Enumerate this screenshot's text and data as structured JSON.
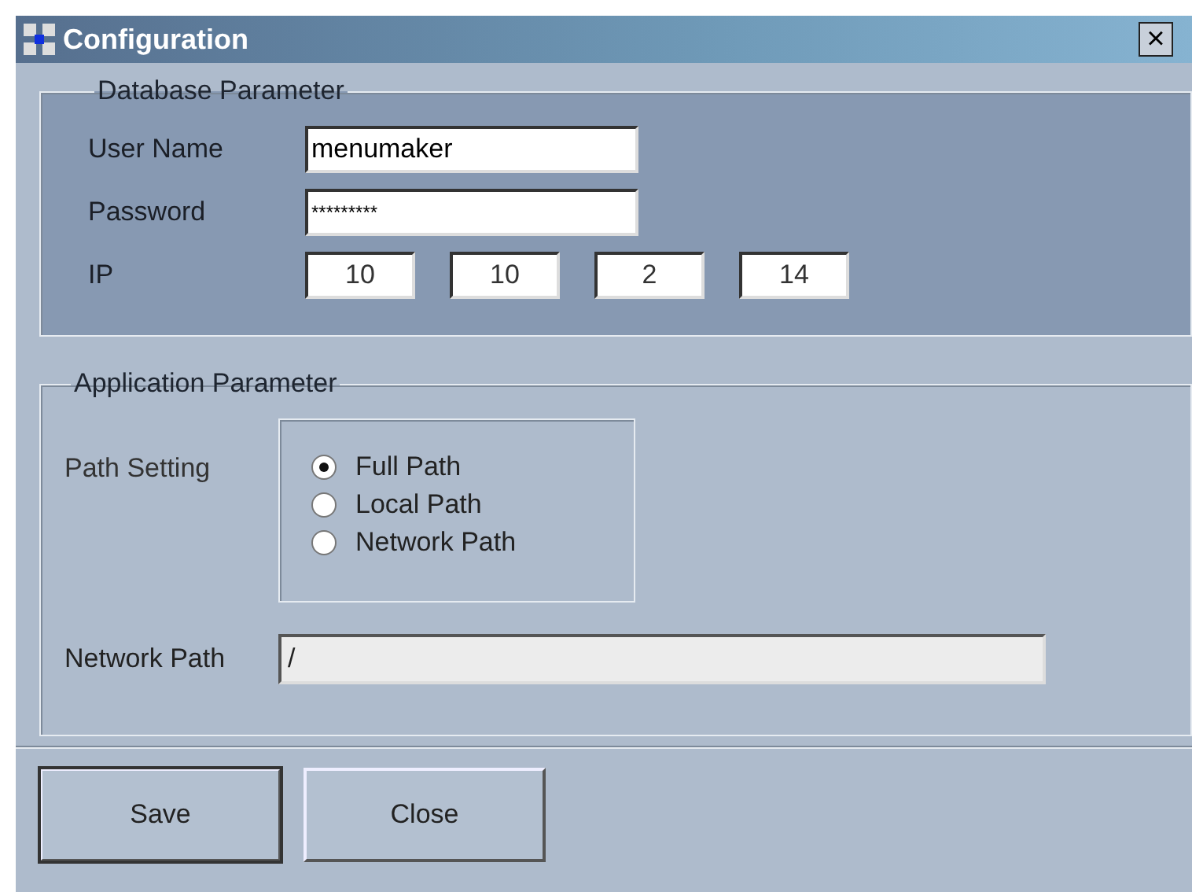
{
  "window": {
    "title": "Configuration",
    "close": "×"
  },
  "database": {
    "title": "Database Parameter",
    "user_name": {
      "label": "User Name",
      "value": "menumaker"
    },
    "password": {
      "label": "Password",
      "value": "*********"
    },
    "ip": {
      "label": "IP",
      "octets": [
        "10",
        "10",
        "2",
        "14"
      ]
    }
  },
  "application": {
    "title": "Application Parameter",
    "path_setting": {
      "label": "Path Setting",
      "options": [
        {
          "label": "Full Path",
          "selected": true
        },
        {
          "label": "Local Path",
          "selected": false
        },
        {
          "label": "Network Path",
          "selected": false
        }
      ]
    },
    "network_path": {
      "label": "Network Path",
      "value": "/",
      "disabled": true
    }
  },
  "buttons": [
    {
      "label": "Save",
      "default": true
    },
    {
      "label": "Close",
      "default": false
    }
  ]
}
